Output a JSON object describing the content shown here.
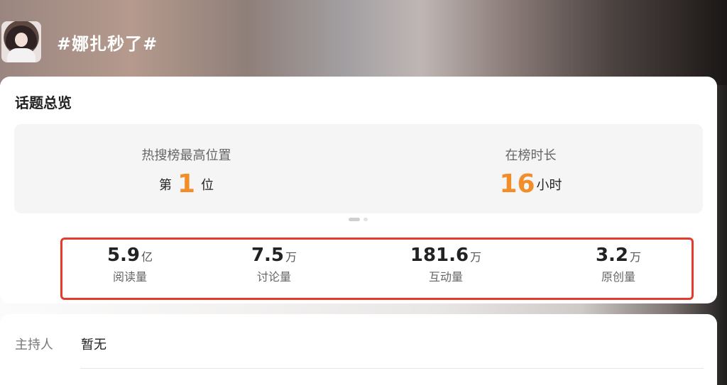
{
  "header": {
    "topic_title": "#娜扎秒了#"
  },
  "overview": {
    "title": "话题总览",
    "hot_search": {
      "label": "热搜榜最高位置",
      "prefix": "第",
      "value": "1",
      "suffix": "位"
    },
    "on_list": {
      "label": "在榜时长",
      "value": "16",
      "suffix": "小时"
    },
    "stats": [
      {
        "value": "5.9",
        "unit": "亿",
        "label": "阅读量"
      },
      {
        "value": "7.5",
        "unit": "万",
        "label": "讨论量"
      },
      {
        "value": "181.6",
        "unit": "万",
        "label": "互动量"
      },
      {
        "value": "3.2",
        "unit": "万",
        "label": "原创量"
      }
    ]
  },
  "host": {
    "label": "主持人",
    "value": "暂无"
  },
  "colors": {
    "accent_orange": "#f18e2a",
    "highlight_red": "#e33b2d"
  }
}
